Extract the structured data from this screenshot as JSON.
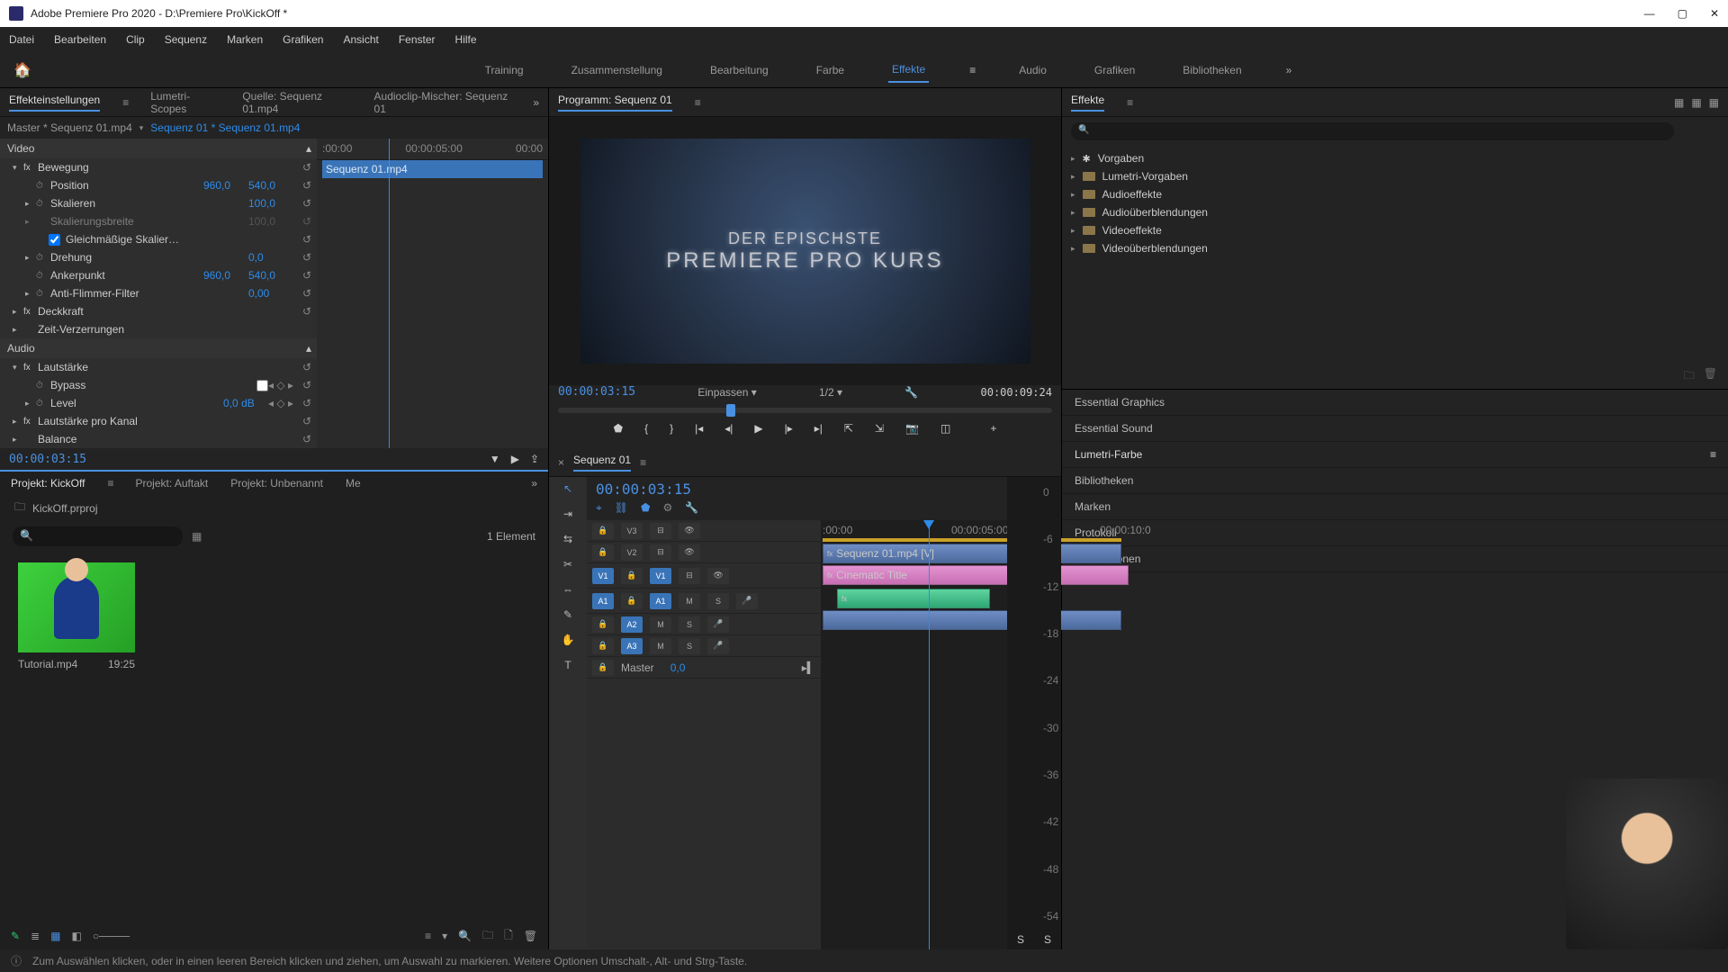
{
  "title": "Adobe Premiere Pro 2020 - D:\\Premiere Pro\\KickOff *",
  "menu": [
    "Datei",
    "Bearbeiten",
    "Clip",
    "Sequenz",
    "Marken",
    "Grafiken",
    "Ansicht",
    "Fenster",
    "Hilfe"
  ],
  "workspaces": [
    "Training",
    "Zusammenstellung",
    "Bearbeitung",
    "Farbe",
    "Effekte",
    "Audio",
    "Grafiken",
    "Bibliotheken"
  ],
  "active_workspace": "Effekte",
  "effect_ctrl_tabs": [
    "Effekteinstellungen",
    "Lumetri-Scopes",
    "Quelle: Sequenz 01.mp4",
    "Audioclip-Mischer: Sequenz 01"
  ],
  "program_tab": "Programm: Sequenz 01",
  "effects_panel_tab": "Effekte",
  "ec_master": "Master * Sequenz 01.mp4",
  "ec_source": "Sequenz 01 * Sequenz 01.mp4",
  "ec_seq_label": "Sequenz 01.mp4",
  "ec_ruler": [
    ":00:00",
    "00:00:05:00",
    "00:00"
  ],
  "ec_sections": {
    "video": "Video",
    "bewegung": "Bewegung",
    "position": {
      "label": "Position",
      "x": "960,0",
      "y": "540,0"
    },
    "skalieren": {
      "label": "Skalieren",
      "v": "100,0"
    },
    "skalierbreite": {
      "label": "Skalierungsbreite",
      "v": "100,0"
    },
    "gleich": "Gleichmäßige Skalier…",
    "drehung": {
      "label": "Drehung",
      "v": "0,0"
    },
    "anker": {
      "label": "Ankerpunkt",
      "x": "960,0",
      "y": "540,0"
    },
    "anti": {
      "label": "Anti-Flimmer-Filter",
      "v": "0,00"
    },
    "deckkraft": "Deckkraft",
    "zeit": "Zeit-Verzerrungen",
    "audio": "Audio",
    "laut": "Lautstärke",
    "bypass": "Bypass",
    "level": {
      "label": "Level",
      "v": "0,0 dB"
    },
    "lautkanal": "Lautstärke pro Kanal",
    "balance": "Balance"
  },
  "ec_timecode": "00:00:03:15",
  "project_tabs": [
    "Projekt: KickOff",
    "Projekt: Auftakt",
    "Projekt: Unbenannt",
    "Me"
  ],
  "project_file": "KickOff.prproj",
  "project_count": "1 Element",
  "thumb": {
    "name": "Tutorial.mp4",
    "dur": "19:25"
  },
  "program_tc_left": "00:00:03:15",
  "program_fit": "Einpassen",
  "program_zoom": "1/2",
  "program_tc_right": "00:00:09:24",
  "timeline_tab": "Sequenz 01",
  "timeline_tc": "00:00:03:15",
  "ruler_marks": {
    "a": ":00:00",
    "b": "00:00:05:00",
    "c": "00:00:10:0"
  },
  "tracks": {
    "v3": "V3",
    "v2": "V2",
    "v1s": "V1",
    "v1": "V1",
    "a1s": "A1",
    "a1": "A1",
    "a2": "A2",
    "a3": "A3",
    "master": "Master",
    "mzero": "0,0",
    "m": "M",
    "s": "S"
  },
  "clips": {
    "seq": "Sequenz 01.mp4 [V]",
    "title": "Cinematic Title"
  },
  "effects_tree": [
    "Vorgaben",
    "Lumetri-Vorgaben",
    "Audioeffekte",
    "Audioüberblendungen",
    "Videoeffekte",
    "Videoüberblendungen"
  ],
  "side_panels": [
    "Essential Graphics",
    "Essential Sound",
    "Lumetri-Farbe",
    "Bibliotheken",
    "Marken",
    "Protokoll",
    "Informationen"
  ],
  "side_active": "Lumetri-Farbe",
  "meter_labels": [
    "0",
    "-6",
    "-12",
    "-18",
    "-24",
    "-30",
    "-36",
    "-42",
    "-48",
    "-54"
  ],
  "meter_ss": "S",
  "status": "Zum Auswählen klicken, oder in einen leeren Bereich klicken und ziehen, um Auswahl zu markieren. Weitere Optionen Umschalt-, Alt- und Strg-Taste.",
  "movie_line1": "DER EPISCHSTE",
  "movie_line2": "PREMIERE PRO KURS"
}
